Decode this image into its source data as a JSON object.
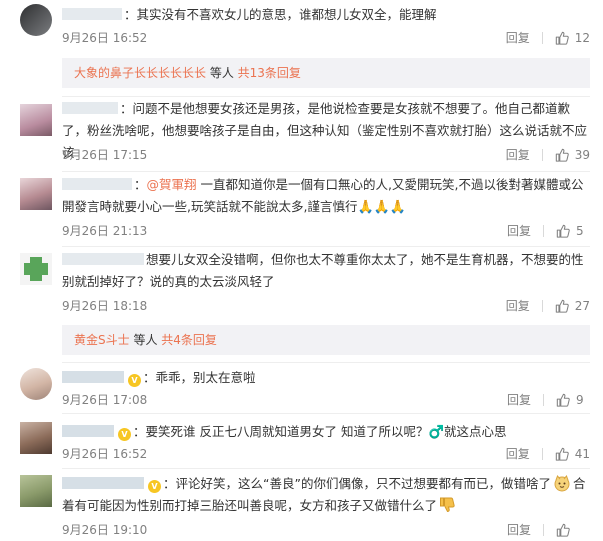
{
  "comments": [
    {
      "text": "：其实没有不喜欢女儿的意思，谁都想儿女双全，能理解",
      "time": "9月26日 16:52",
      "reply": "回复",
      "likes": "12",
      "colors": {
        "avatar": "#6b6e70"
      }
    },
    {
      "text": "：问题不是他想要女孩还是男孩，是他说检查要是女孩就不想要了。他自己都道歉了，粉丝洗啥呢，他想要啥孩子是自由，但这种认知（鉴定性别不喜欢就打胎）这么说话就不应该",
      "time": "9月26日 17:15",
      "reply": "回复",
      "likes": "39",
      "colors": {
        "avatar": "#c9a7b5"
      }
    },
    {
      "mention": "@賀軍翔",
      "text": "一直都知道你是一個有口無心的人,又愛開玩笑,不過以後對著媒體或公開發言時就要小心一些,玩笑話就不能說太多,謹言慎行",
      "emoji": "🙏🙏🙏",
      "time": "9月26日 21:13",
      "reply": "回复",
      "likes": "5",
      "colors": {
        "avatar": "#b69a9c"
      }
    },
    {
      "text": "想要儿女双全没错啊，但你也太不尊重你太太了，她不是生育机器，不想要的性别就刮掉好了？说的真的太云淡风轻了",
      "time": "9月26日 18:18",
      "reply": "回复",
      "likes": "27",
      "colors": {
        "avatar": "#5fa35f"
      }
    },
    {
      "text": "：乖乖，别太在意啦",
      "time": "9月26日 17:08",
      "reply": "回复",
      "likes": "9",
      "colors": {
        "avatar": "#d8c3b7"
      }
    },
    {
      "text": "：要笑死谁 反正七八周就知道男女了 知道了所以呢？♂️就这点心思",
      "time": "9月26日 16:52",
      "reply": "回复",
      "likes": "41",
      "colors": {
        "avatar": "#8c6c5a"
      }
    },
    {
      "text": "：评论好笑，这么“善良”的你们偶像，只不过想要都有而已，做错啥了",
      "text2": "合着有可能因为性别而打掉三胎还叫善良呢，女方和孩子又做错什么了",
      "time": "9月26日 19:10",
      "reply": "回复",
      "likes": "",
      "colors": {
        "avatar": "#8a9a6a"
      }
    }
  ],
  "more_replies": [
    {
      "user": "大象的鼻子长长长长长长",
      "middle": " 等人 ",
      "total": "共13条回复"
    },
    {
      "user": "黄金S斗士",
      "middle": " 等人 ",
      "total": "共4条回复"
    }
  ],
  "icons": {
    "like": "thumbs-up-icon",
    "vip": "vip-badge-icon",
    "emoji_a": "cute-face-emoji-icon",
    "emoji_b": "thumbs-down-emoji-icon"
  },
  "colors": {
    "link": "#eb7350",
    "meta": "#808080",
    "more_bg": "#f2f2f5"
  }
}
